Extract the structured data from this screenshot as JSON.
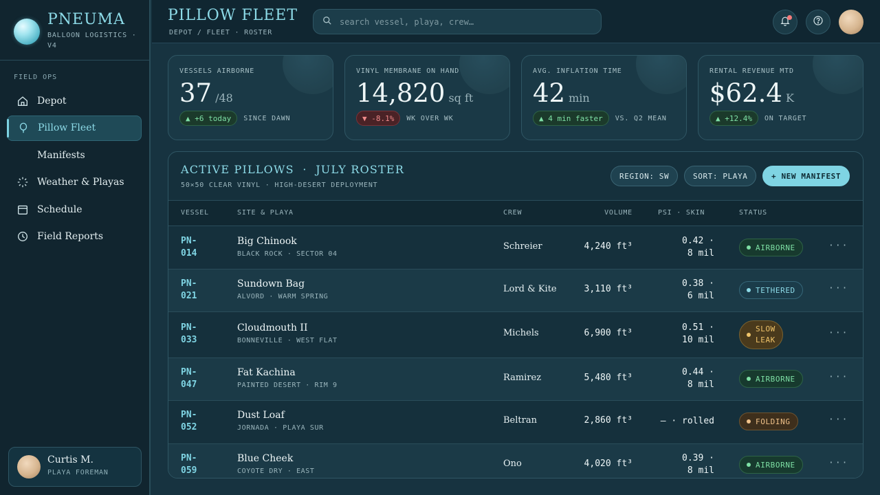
{
  "brand": {
    "name": "PNEUMA",
    "sub": "BALLOON LOGISTICS · V4"
  },
  "sidebar": {
    "section": "FIELD OPS",
    "items": [
      {
        "label": "Depot",
        "icon": "home-icon"
      },
      {
        "label": "Pillow Fleet",
        "icon": "balloon-icon",
        "active": true
      },
      {
        "label": "Manifests",
        "icon": ""
      },
      {
        "label": "Weather & Playas",
        "icon": "weather-icon"
      },
      {
        "label": "Schedule",
        "icon": "calendar-icon"
      },
      {
        "label": "Field Reports",
        "icon": "clock-icon"
      }
    ],
    "user": {
      "name": "Curtis M.",
      "role": "PLAYA FOREMAN"
    }
  },
  "header": {
    "title": "PILLOW FLEET",
    "breadcrumb": "DEPOT / FLEET · ROSTER",
    "search_placeholder": "search vessel, playa, crew…"
  },
  "kpis": [
    {
      "label": "VESSELS AIRBORNE",
      "value": "37",
      "unit": "/48",
      "delta": "▲ +6 today",
      "trend": "up",
      "note": "SINCE DAWN"
    },
    {
      "label": "VINYL MEMBRANE ON HAND",
      "value": "14,820",
      "unit": "sq ft",
      "delta": "▼ -8.1%",
      "trend": "down",
      "note": "WK OVER WK"
    },
    {
      "label": "AVG. INFLATION TIME",
      "value": "42",
      "unit": "min",
      "delta": "▲ 4 min faster",
      "trend": "up",
      "note": "VS. Q2 MEAN"
    },
    {
      "label": "RENTAL REVENUE MTD",
      "value": "$62.4",
      "unit": "K",
      "delta": "▲ +12.4%",
      "trend": "up",
      "note": "ON TARGET"
    }
  ],
  "panel": {
    "title": "ACTIVE PILLOWS  ·  JULY ROSTER",
    "subtitle": "50×50 CLEAR VINYL · HIGH-DESERT DEPLOYMENT",
    "region_button": "REGION: SW",
    "sort_button": "SORT: PLAYA",
    "new_button": "+ NEW MANIFEST",
    "columns": [
      "VESSEL",
      "SITE & PLAYA",
      "CREW",
      "VOLUME",
      "PSI · SKIN",
      "STATUS"
    ],
    "rows": [
      {
        "id_a": "PN-",
        "id_b": "014",
        "name": "Big Chinook",
        "loc": "BLACK ROCK · SECTOR 04",
        "crew": "Schreier",
        "volume": "4,240 ft³",
        "psi_a": "0.42 ·",
        "psi_b": "8 mil",
        "status": "AIRBORNE",
        "status_b": "",
        "kind": "good"
      },
      {
        "id_a": "PN-",
        "id_b": "021",
        "name": "Sundown Bag",
        "loc": "ALVORD · WARM SPRING",
        "crew": "Lord & Kite",
        "volume": "3,110 ft³",
        "psi_a": "0.38 ·",
        "psi_b": "6 mil",
        "status": "TETHERED",
        "status_b": "",
        "kind": "teth"
      },
      {
        "id_a": "PN-",
        "id_b": "033",
        "name": "Cloudmouth II",
        "loc": "BONNEVILLE · WEST FLAT",
        "crew": "Michels",
        "volume": "6,900 ft³",
        "psi_a": "0.51 ·",
        "psi_b": "10 mil",
        "status": "SLOW",
        "status_b": "LEAK",
        "kind": "warn"
      },
      {
        "id_a": "PN-",
        "id_b": "047",
        "name": "Fat Kachina",
        "loc": "PAINTED DESERT · RIM 9",
        "crew": "Ramirez",
        "volume": "5,480 ft³",
        "psi_a": "0.44 ·",
        "psi_b": "8 mil",
        "status": "AIRBORNE",
        "status_b": "",
        "kind": "good"
      },
      {
        "id_a": "PN-",
        "id_b": "052",
        "name": "Dust Loaf",
        "loc": "JORNADA · PLAYA SUR",
        "crew": "Beltran",
        "volume": "2,860 ft³",
        "psi_a": "— · rolled",
        "psi_b": "",
        "status": "FOLDING",
        "status_b": "",
        "kind": "fold"
      },
      {
        "id_a": "PN-",
        "id_b": "059",
        "name": "Blue Cheek",
        "loc": "COYOTE DRY · EAST",
        "crew": "Ono",
        "volume": "4,020 ft³",
        "psi_a": "0.39 ·",
        "psi_b": "8 mil",
        "status": "AIRBORNE",
        "status_b": "",
        "kind": "good"
      }
    ],
    "more_label": "···"
  }
}
